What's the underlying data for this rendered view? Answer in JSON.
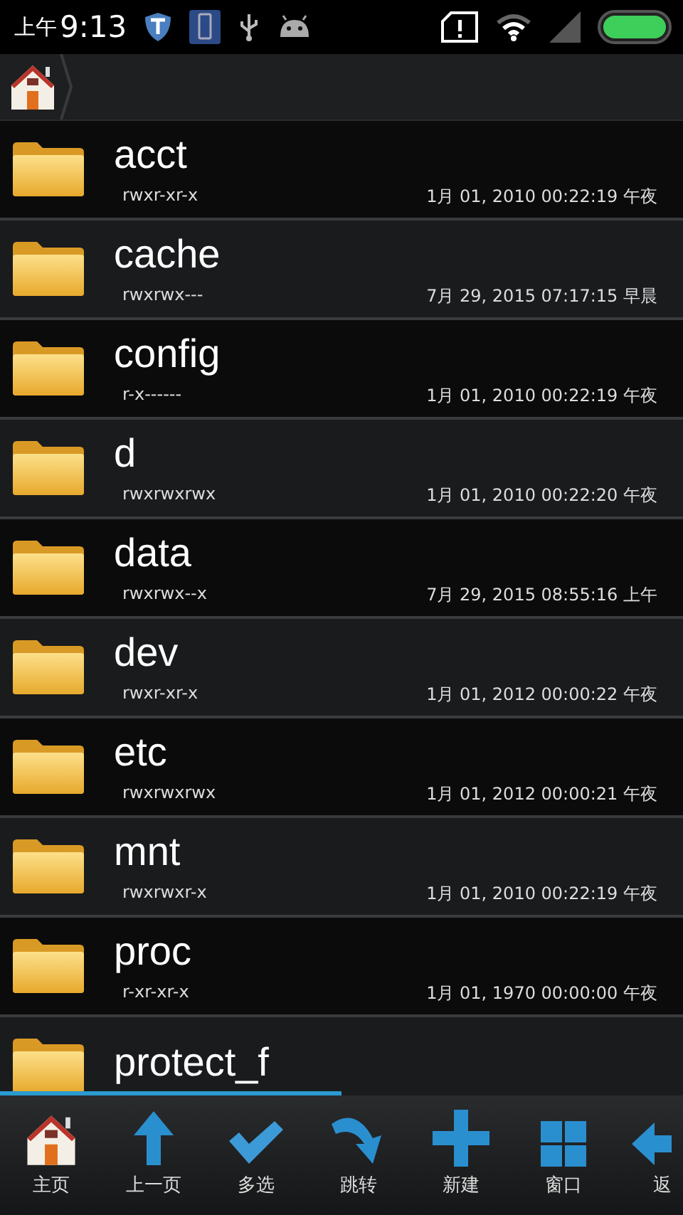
{
  "status_bar": {
    "ampm": "上午",
    "time": "9:13"
  },
  "files": [
    {
      "name": "acct",
      "permissions": "rwxr-xr-x",
      "modified": "1月 01, 2010 00:22:19 午夜"
    },
    {
      "name": "cache",
      "permissions": "rwxrwx---",
      "modified": "7月 29, 2015 07:17:15 早晨"
    },
    {
      "name": "config",
      "permissions": "r-x------",
      "modified": "1月 01, 2010 00:22:19 午夜"
    },
    {
      "name": "d",
      "permissions": "rwxrwxrwx",
      "modified": "1月 01, 2010 00:22:20 午夜"
    },
    {
      "name": "data",
      "permissions": "rwxrwx--x",
      "modified": "7月 29, 2015 08:55:16 上午"
    },
    {
      "name": "dev",
      "permissions": "rwxr-xr-x",
      "modified": "1月 01, 2012 00:00:22 午夜"
    },
    {
      "name": "etc",
      "permissions": "rwxrwxrwx",
      "modified": "1月 01, 2012 00:00:21 午夜"
    },
    {
      "name": "mnt",
      "permissions": "rwxrwxr-x",
      "modified": "1月 01, 2010 00:22:19 午夜"
    },
    {
      "name": "proc",
      "permissions": "r-xr-xr-x",
      "modified": "1月 01, 1970 00:00:00 午夜"
    },
    {
      "name": "protect_f"
    }
  ],
  "toolbar": [
    {
      "kind": "home",
      "label": "主页"
    },
    {
      "kind": "up",
      "label": "上一页"
    },
    {
      "kind": "multi",
      "label": "多选"
    },
    {
      "kind": "jump",
      "label": "跳转"
    },
    {
      "kind": "new",
      "label": "新建"
    },
    {
      "kind": "window",
      "label": "窗口"
    },
    {
      "kind": "back",
      "label": "返"
    }
  ]
}
